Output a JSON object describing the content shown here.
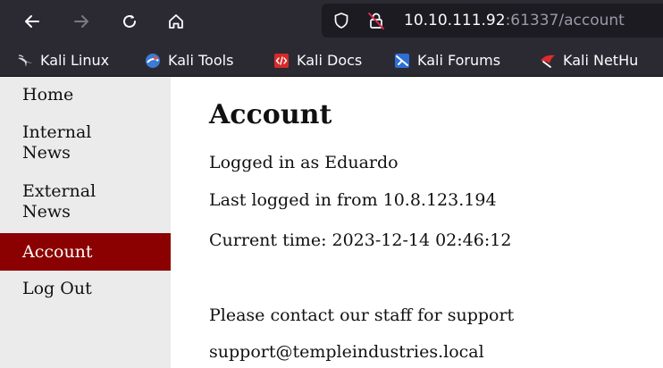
{
  "browser": {
    "url": {
      "host": "10.10.111.92",
      "rest": ":61337/account"
    },
    "bookmarks": [
      {
        "label": "Kali Linux",
        "icon": "kali-dragon-icon"
      },
      {
        "label": "Kali Tools",
        "icon": "kali-tools-icon"
      },
      {
        "label": "Kali Docs",
        "icon": "kali-docs-icon"
      },
      {
        "label": "Kali Forums",
        "icon": "kali-forums-icon"
      },
      {
        "label": "Kali NetHu",
        "icon": "kali-nethunter-icon"
      }
    ]
  },
  "sidebar": {
    "items": [
      {
        "label": "Home"
      },
      {
        "label_line1": "Internal",
        "label_line2": "News"
      },
      {
        "label_line1": "External",
        "label_line2": "News"
      },
      {
        "label": "Account"
      },
      {
        "label": "Log Out"
      }
    ],
    "active_color": "#8b0000"
  },
  "main": {
    "title": "Account",
    "logged_in_as": "Logged in as Eduardo",
    "last_login": "Last logged in from 10.8.123.194",
    "current_time": "Current time: 2023-12-14 02:46:12",
    "support_text": "Please contact our staff for support",
    "support_email": "support@templeindustries.local"
  }
}
